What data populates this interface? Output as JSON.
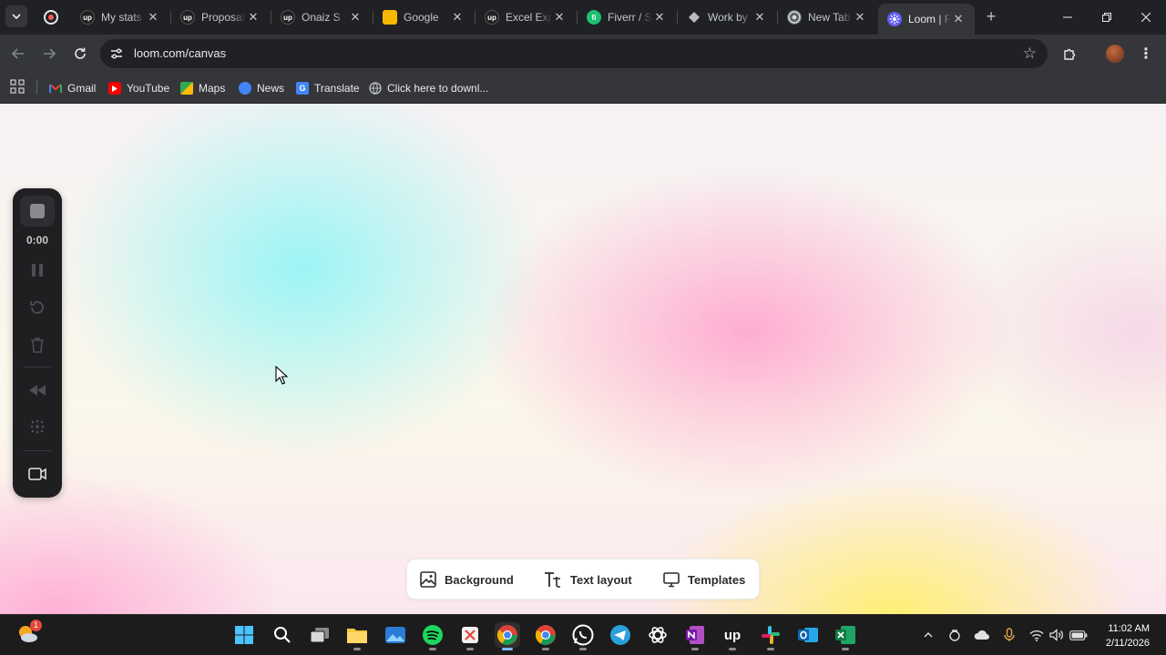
{
  "browser": {
    "tabs": [
      {
        "title": "My stats",
        "favicon": "upwork-icon"
      },
      {
        "title": "Proposal",
        "favicon": "upwork-icon"
      },
      {
        "title": "Onaiz S",
        "favicon": "upwork-icon"
      },
      {
        "title": "Google",
        "favicon": "google-keep-icon"
      },
      {
        "title": "Excel Exp",
        "favicon": "upwork-icon"
      },
      {
        "title": "Fiverr / S",
        "favicon": "fiverr-icon"
      },
      {
        "title": "Work by",
        "favicon": "github-icon"
      },
      {
        "title": "New Tab",
        "favicon": "chrome-icon"
      },
      {
        "title": "Loom | F",
        "favicon": "loom-icon",
        "active": true
      }
    ],
    "url": "loom.com/canvas",
    "bookmarks": [
      {
        "label": "Gmail",
        "icon": "gmail-icon"
      },
      {
        "label": "YouTube",
        "icon": "youtube-icon"
      },
      {
        "label": "Maps",
        "icon": "maps-icon"
      },
      {
        "label": "News",
        "icon": "news-icon"
      },
      {
        "label": "Translate",
        "icon": "translate-icon"
      },
      {
        "label": "Click here to downl...",
        "icon": "globe-icon"
      }
    ]
  },
  "recorder": {
    "timer": "0:00",
    "controls": [
      "stop-icon",
      "pause-icon",
      "restart-icon",
      "delete-icon",
      "rewind-icon",
      "effects-icon",
      "camera-icon"
    ]
  },
  "canvas_toolbar": {
    "background_label": "Background",
    "text_layout_label": "Text layout",
    "templates_label": "Templates"
  },
  "taskbar": {
    "time": "11:02 AM",
    "date": "2/11/2026",
    "weather_badge": "1"
  },
  "colors": {
    "accent_active_tab": "#35363a",
    "loom_blue": "#625df5",
    "gradient_cyan": "#96f5f5",
    "gradient_pink": "#ffa0cd",
    "gradient_yellow": "#fff06e"
  }
}
